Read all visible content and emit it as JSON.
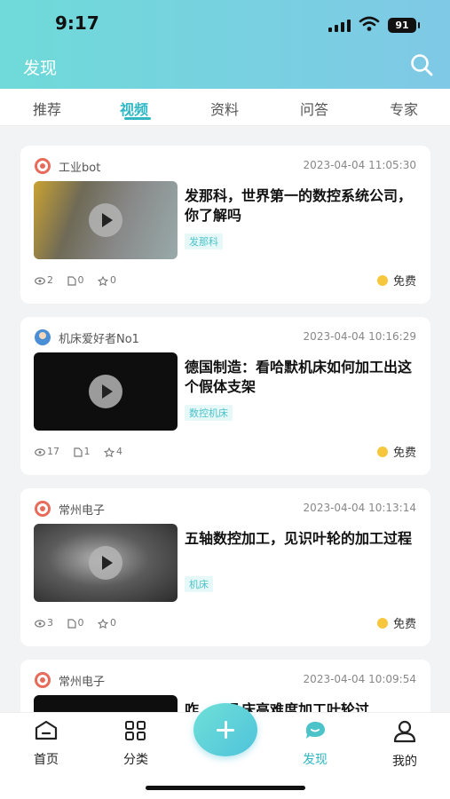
{
  "status_bar": {
    "time": "9:17",
    "battery": "91"
  },
  "header": {
    "title": "发现"
  },
  "tabs": [
    {
      "label": "推荐"
    },
    {
      "label": "视频"
    },
    {
      "label": "资料"
    },
    {
      "label": "问答"
    },
    {
      "label": "专家"
    }
  ],
  "active_tab": "视频",
  "cards": [
    {
      "author": "工业bot",
      "date": "2023-04-04 11:05:30",
      "title": "发那科，世界第一的数控系统公司，你了解吗",
      "tag": "发那科",
      "views": "2",
      "files": "0",
      "stars": "0",
      "price": "免费"
    },
    {
      "author": "机床爱好者No1",
      "date": "2023-04-04 10:16:29",
      "title": "德国制造：看哈默机床如何加工出这个假体支架",
      "tag": "数控机床",
      "views": "17",
      "files": "1",
      "stars": "4",
      "price": "免费"
    },
    {
      "author": "常州电子",
      "date": "2023-04-04 10:13:14",
      "title": "五轴数控加工，见识叶轮的加工过程",
      "tag": "机床",
      "views": "3",
      "files": "0",
      "stars": "0",
      "price": "免费"
    },
    {
      "author": "常州电子",
      "date": "2023-04-04 10:09:54",
      "title": "咋……几床高难度加工叶轮过",
      "tag": "",
      "views": "",
      "files": "",
      "stars": "",
      "price": ""
    }
  ],
  "bottom_nav": [
    {
      "label": "首页",
      "icon": "home-icon"
    },
    {
      "label": "分类",
      "icon": "grid-icon"
    },
    {
      "label": "发现",
      "icon": "chat-bubble-icon"
    },
    {
      "label": "我的",
      "icon": "person-icon"
    }
  ],
  "colors": {
    "accent": "#2fb8c4",
    "header_start": "#6fdad9",
    "header_end": "#7fc9e6",
    "coin": "#f6c73c"
  }
}
